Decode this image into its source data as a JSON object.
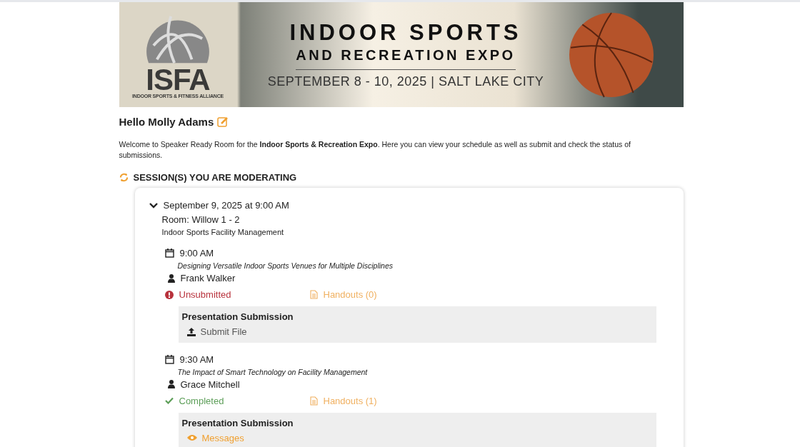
{
  "banner": {
    "logo_text": "ISFA",
    "logo_subtitle": "INDOOR SPORTS & FITNESS ALLIANCE",
    "title": "INDOOR SPORTS",
    "subtitle": "AND RECREATION EXPO",
    "dates": "SEPTEMBER 8 - 10, 2025 | SALT LAKE CITY"
  },
  "greeting": "Hello Molly Adams",
  "welcome": "Welcome to Speaker Ready Room for the **Indoor Sports & Recreation Expo**. Here you can view your schedule as well as submit and check the status of submissions.",
  "section_title": "SESSION(S) YOU ARE MODERATING",
  "block": {
    "expanded": true,
    "datetime": "September 9, 2025 at 9:00 AM",
    "room": "Room: Willow 1 - 2",
    "track": "Indoor Sports Facility Management",
    "sessions": [
      {
        "time": "9:00 AM",
        "title": "Designing Versatile Indoor Sports Venues for Multiple Disciplines",
        "speaker": "Frank Walker",
        "status": {
          "kind": "unsubmitted",
          "label": "Unsubmitted"
        },
        "handouts": "Handouts (0)",
        "submission_heading": "Presentation Submission",
        "action": {
          "kind": "upload",
          "label": "Submit File"
        }
      },
      {
        "time": "9:30 AM",
        "title": "The Impact of Smart Technology on Facility Management",
        "speaker": "Grace Mitchell",
        "status": {
          "kind": "completed",
          "label": "Completed"
        },
        "handouts": "Handouts (1)",
        "submission_heading": "Presentation Submission",
        "action": {
          "kind": "messages",
          "label": "Messages"
        }
      }
    ]
  }
}
